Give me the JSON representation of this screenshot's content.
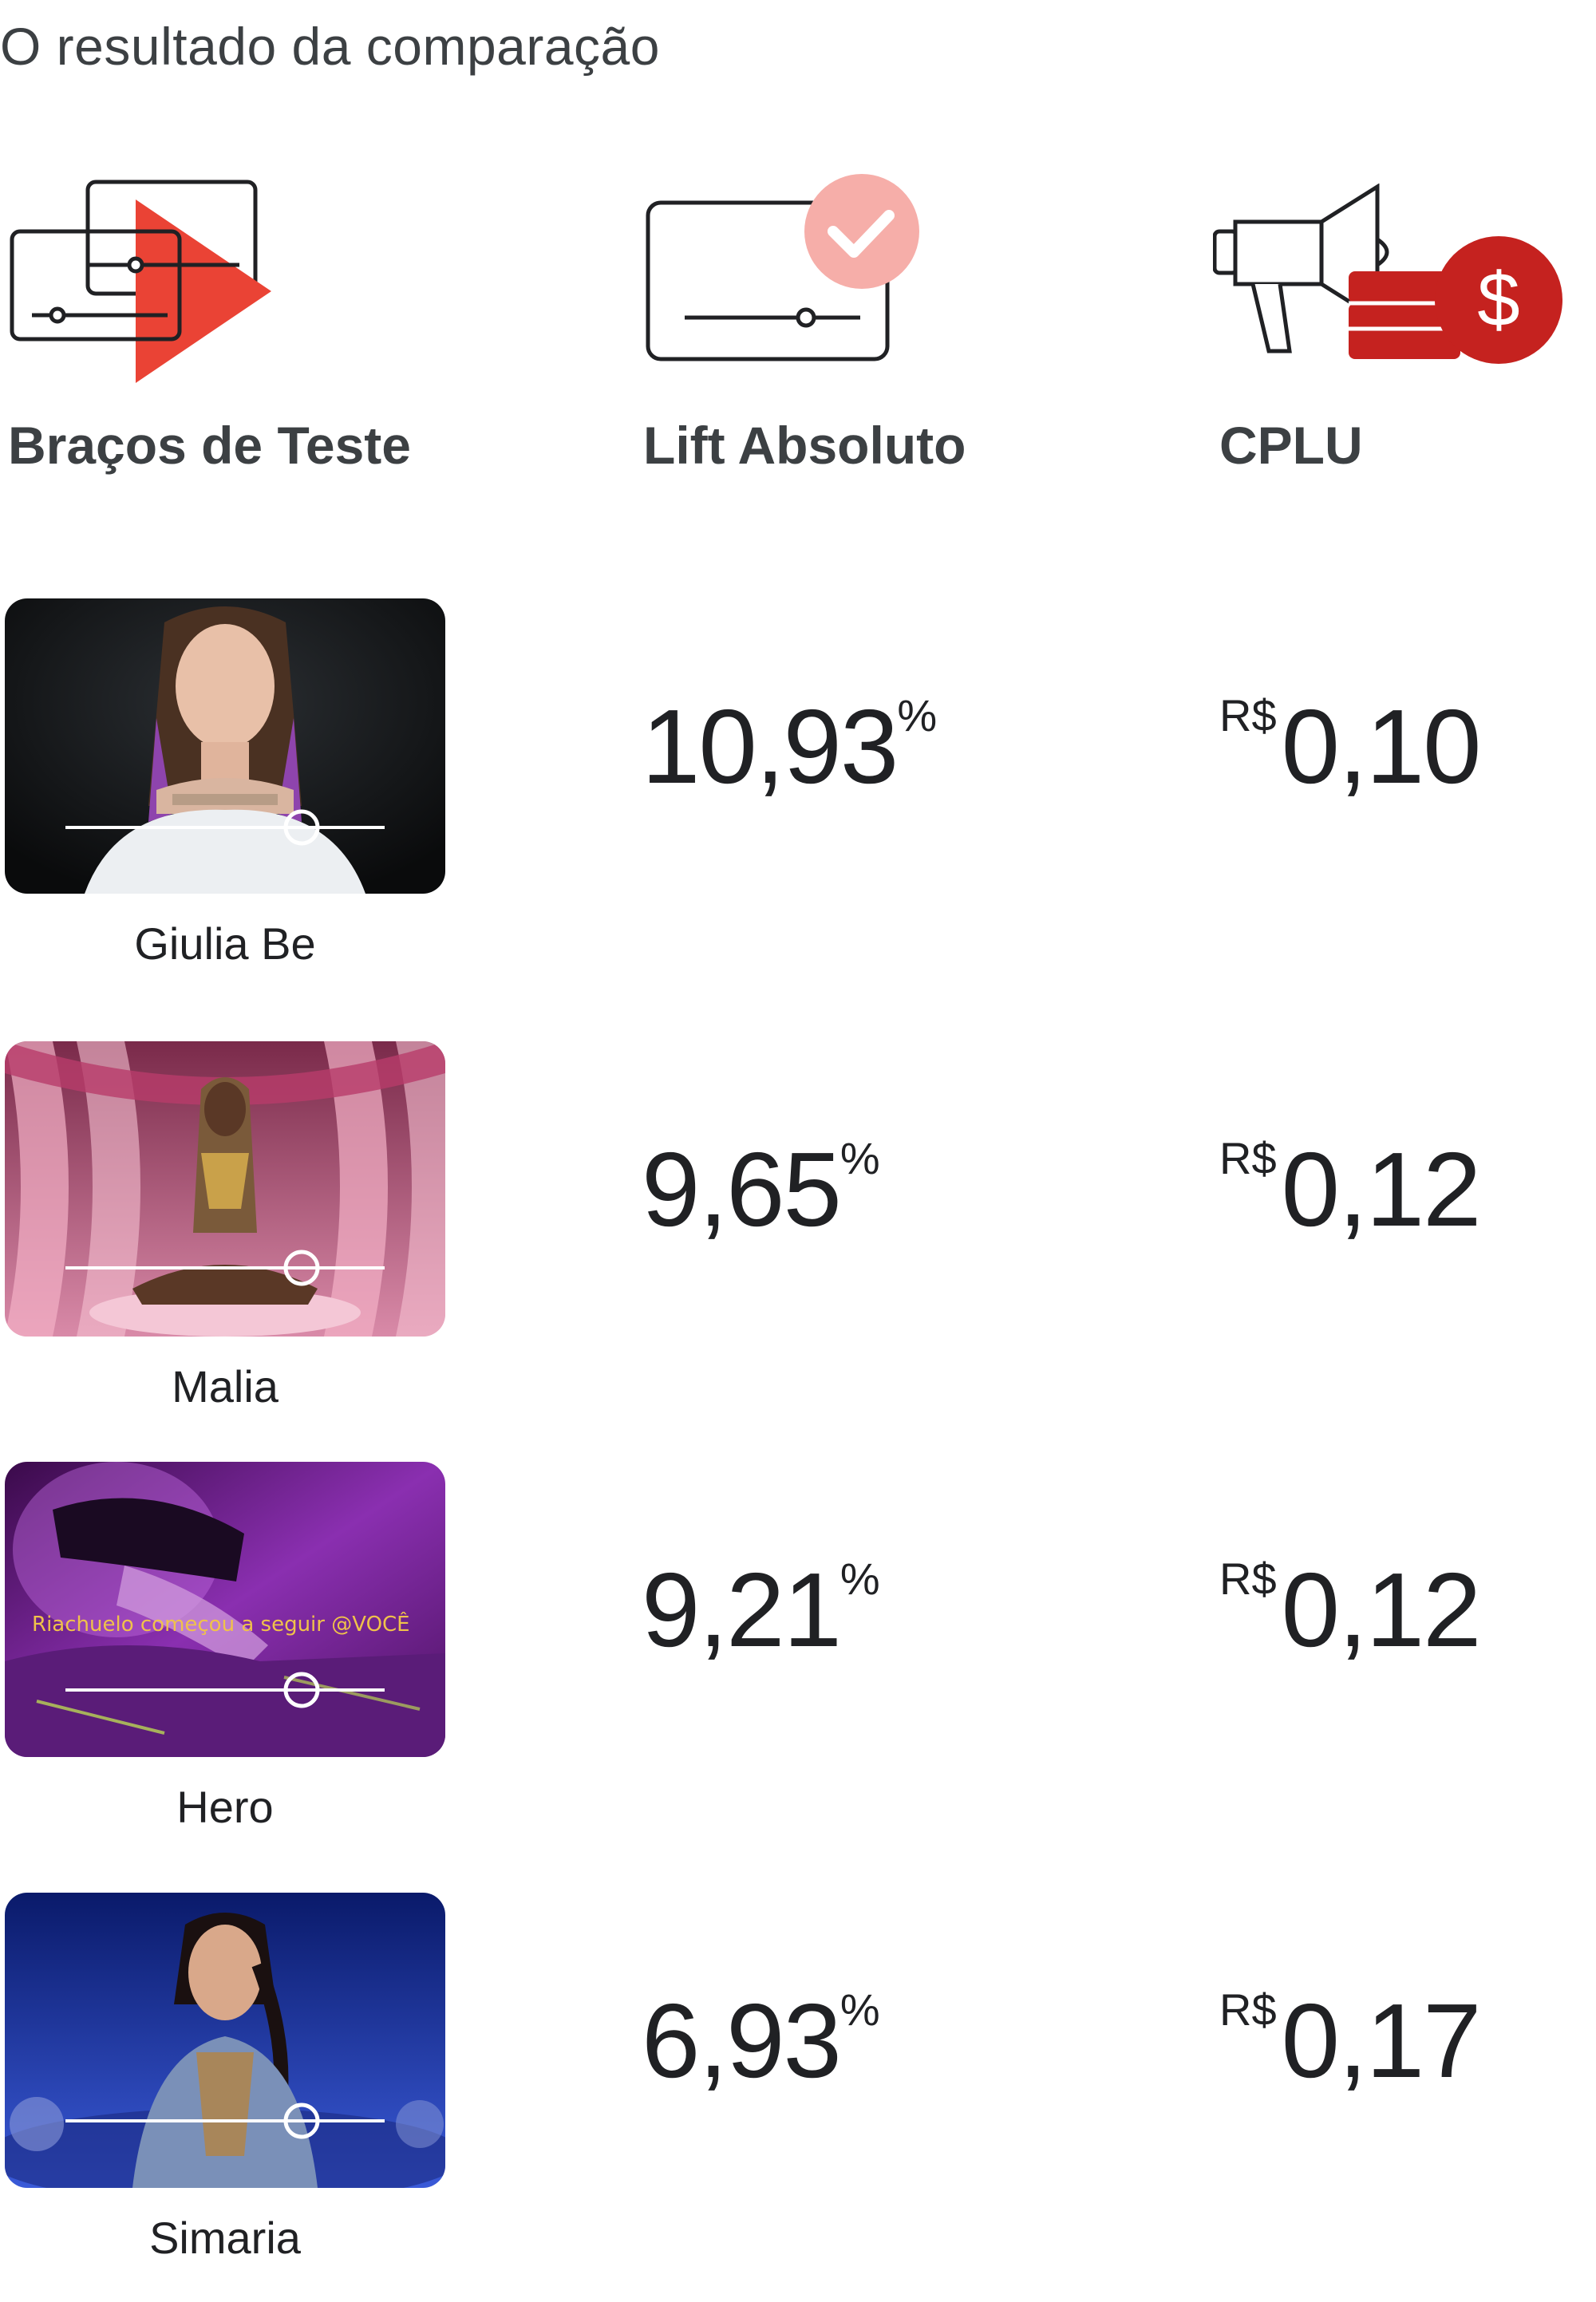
{
  "header": {
    "title": "O resultado da comparação"
  },
  "columns": [
    {
      "label": "Braços de Teste",
      "icon": "video-variants-icon"
    },
    {
      "label": "Lift Absoluto",
      "icon": "video-check-icon"
    },
    {
      "label": "CPLU",
      "icon": "megaphone-coins-icon"
    }
  ],
  "colors": {
    "accent_red": "#ea4335",
    "dark_red": "#c5221f",
    "check_pink": "#f6aea9",
    "text": "#202124"
  },
  "rows": [
    {
      "name": "Giulia Be",
      "lift": "10,93",
      "lift_unit": "%",
      "currency": "R$",
      "cplu": "0,10",
      "slider_position": 0.74
    },
    {
      "name": "Malia",
      "lift": "9,65",
      "lift_unit": "%",
      "currency": "R$",
      "cplu": "0,12",
      "slider_position": 0.74
    },
    {
      "name": "Hero",
      "lift": "9,21",
      "lift_unit": "%",
      "currency": "R$",
      "cplu": "0,12",
      "slider_position": 0.74,
      "overlay_text": "Riachuelo começou a seguir @VOCÊ"
    },
    {
      "name": "Simaria",
      "lift": "6,93",
      "lift_unit": "%",
      "currency": "R$",
      "cplu": "0,17",
      "slider_position": 0.74
    }
  ]
}
